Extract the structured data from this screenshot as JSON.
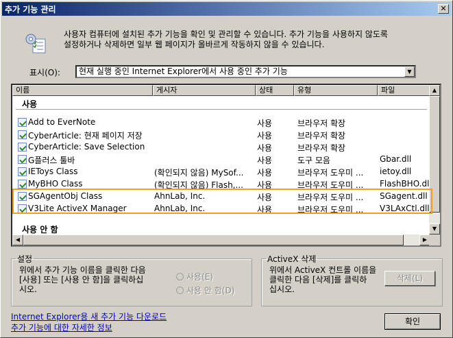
{
  "window": {
    "title": "추가 기능 관리",
    "close_label": "✕"
  },
  "intro": {
    "text_line1": "사용자 컴퓨터에 설치된 추가 기능을 확인 및 관리할 수 있습니다. 추가 기능을 사용하지 않도록",
    "text_line2": "설정하거나 삭제하면 일부 웹 페이지가 올바르게 작동하지 않을 수 있습니다."
  },
  "show": {
    "label": "표시(O):",
    "selected": "현재 실행 중인 Internet Explorer에서 사용 중인 추가 기능"
  },
  "list": {
    "columns": [
      "이름",
      "게시자",
      "상태",
      "유형",
      "파일"
    ],
    "group_enabled": "사용",
    "group_disabled": "사용 안 함",
    "rows": [
      {
        "name": "Add to EverNote",
        "publisher": "",
        "status": "사용",
        "type": "브라우저 확장",
        "file": ""
      },
      {
        "name": "CyberArticle: 현재 페이지 저장",
        "publisher": "",
        "status": "사용",
        "type": "브라우저 확장",
        "file": ""
      },
      {
        "name": "CyberArticle: Save Selection",
        "publisher": "",
        "status": "사용",
        "type": "브라우저 확장",
        "file": ""
      },
      {
        "name": "G플러스 툴바",
        "publisher": "",
        "status": "사용",
        "type": "도구 모음",
        "file": "Gbar.dll"
      },
      {
        "name": "IEToys Class",
        "publisher": "(확인되지 않음) MySof...",
        "status": "사용",
        "type": "브라우저 도우미 ...",
        "file": "ietoy.dll"
      },
      {
        "name": "MyBHO Class",
        "publisher": "(확인되지 않음) Flash,...",
        "status": "사용",
        "type": "브라우저 도우미 ...",
        "file": "FlashBHO.dll"
      },
      {
        "name": "SGAgentObj Class",
        "publisher": "AhnLab, Inc.",
        "status": "사용",
        "type": "브라우저 도우미 ...",
        "file": "SGagent.dll"
      },
      {
        "name": "V3Lite ActiveX Manager",
        "publisher": "AhnLab, Inc.",
        "status": "사용",
        "type": "브라우저 도우미 ...",
        "file": "V3LAxCtl.dll"
      }
    ]
  },
  "settings": {
    "legend": "설정",
    "text_line1": "위에서 추가 기능 이름을 클릭한 다음",
    "text_line2": "[사용] 또는 [사용 안 함]을 클릭하십",
    "text_line3": "시오.",
    "radio_enable": "사용(E)",
    "radio_disable": "사용 안 함(D)"
  },
  "activex": {
    "legend": "ActiveX 삭제",
    "text_line1": "위에서 ActiveX 컨트롤 이름을",
    "text_line2": "클릭한 다음 [삭제]를 클릭하",
    "text_line3": "십시오.",
    "delete_label": "삭제(L)"
  },
  "links": {
    "download": "Internet Explorer용 새 추가 기능 다운로드",
    "more_info": "추가 기능에 대한 자세한 정보"
  },
  "ok_label": "확인"
}
